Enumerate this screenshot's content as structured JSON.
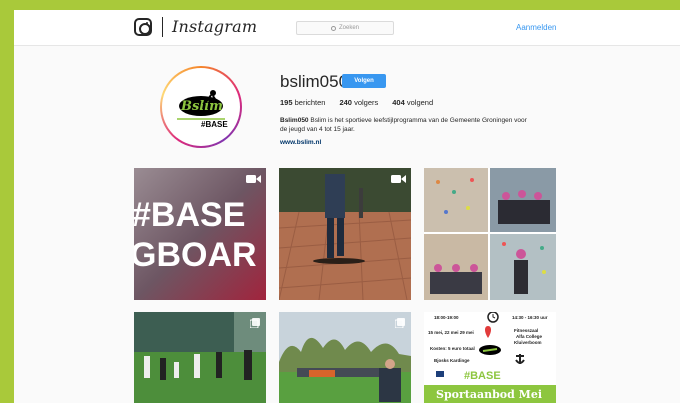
{
  "app": {
    "wordmark": "Instagram",
    "search_placeholder": "Zoeken",
    "login_label": "Aanmelden"
  },
  "profile": {
    "username": "bslim050",
    "follow_label": "Volgen",
    "stats": {
      "posts_count": "195",
      "posts_label": "berichten",
      "followers_count": "240",
      "followers_label": "volgers",
      "following_count": "404",
      "following_label": "volgend"
    },
    "bio_name": "Bslim050",
    "bio_line1": "Bslim is het sportieve leefstijlprogramma van de Gemeente Groningen voor",
    "bio_line2": "de jeugd van 4 tot 15 jaar.",
    "link": "www.bslim.nl",
    "avatar_logo_text": "Bslim",
    "avatar_tag": "#BASE"
  },
  "grid": {
    "post1_line1": "#BASE",
    "post1_line2": "GBOAR",
    "poster": {
      "left_time": "18:00-19:00",
      "dates": "15 mei, 22 mei 29 mei",
      "cost": "Kosten: 5 euro totaal",
      "place": "Bjosks Kardinge",
      "right_time": "14:30 - 16:30 uur",
      "venue1": "Fitnesszaal",
      "venue2": "Alfa College",
      "venue3": "Kluiverboom",
      "tag": "#BASE",
      "banner": "Sportaanbod Mei"
    }
  },
  "colors": {
    "accent": "#3897f0",
    "frame": "#a9c93a",
    "link": "#003569"
  }
}
